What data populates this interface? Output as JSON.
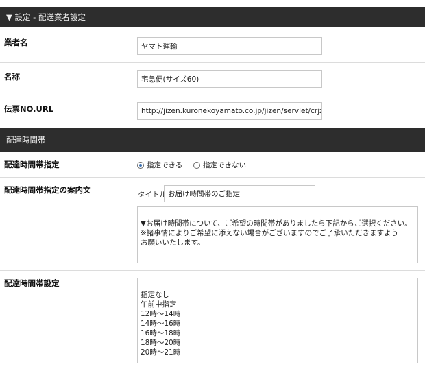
{
  "sections": {
    "settings_header": "▼ 設定 - 配送業者設定",
    "time_header": "配達時間帯"
  },
  "carrier": {
    "label": "業者名",
    "value": "ヤマト運輸"
  },
  "service": {
    "label": "名称",
    "value": "宅急便(サイズ60)"
  },
  "tracking": {
    "label": "伝票NO.URL",
    "value": "http://jizen.kuronekoyamato.co.jp/jizen/servlet/crjz"
  },
  "time_designation": {
    "label": "配達時間帯指定",
    "options": [
      {
        "label": "指定できる",
        "selected": true
      },
      {
        "label": "指定できない",
        "selected": false
      }
    ]
  },
  "guide_text": {
    "label": "配達時間帯指定の案内文",
    "title_label": "タイトル",
    "title_value": "お届け時間帯のご指定",
    "body": "▼お届け時間帯について、ご希望の時間帯がありましたら下記からご選択ください。\n※諸事情によりご希望に添えない場合がございますのでご了承いただきますよう\nお願いいたします。"
  },
  "time_slots": {
    "label": "配達時間帯設定",
    "body": "指定なし\n午前中指定\n12時～14時\n14時～16時\n16時～18時\n18時～20時\n20時～21時"
  }
}
